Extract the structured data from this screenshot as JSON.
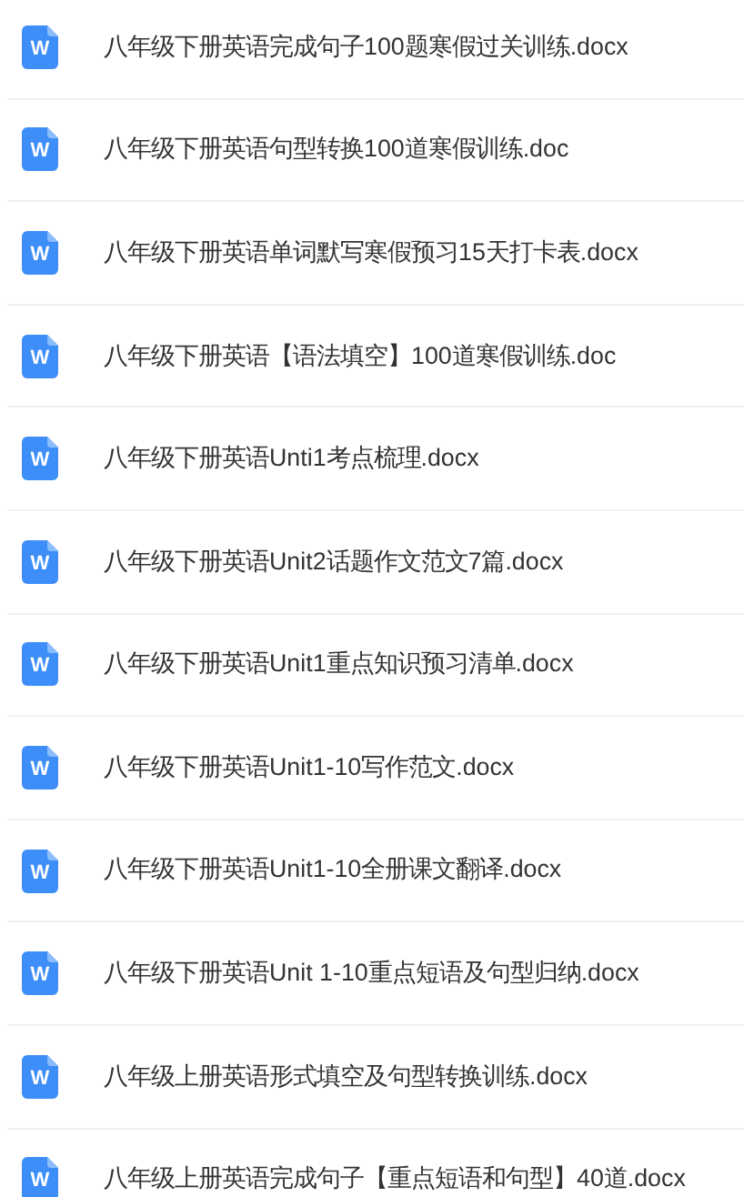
{
  "files": [
    {
      "icon": "W",
      "name": "八年级下册英语完成句子100题寒假过关训练.docx"
    },
    {
      "icon": "W",
      "name": "八年级下册英语句型转换100道寒假训练.doc"
    },
    {
      "icon": "W",
      "name": "八年级下册英语单词默写寒假预习15天打卡表.docx"
    },
    {
      "icon": "W",
      "name": "八年级下册英语【语法填空】100道寒假训练.doc"
    },
    {
      "icon": "W",
      "name": "八年级下册英语Unti1考点梳理.docx"
    },
    {
      "icon": "W",
      "name": "八年级下册英语Unit2话题作文范文7篇.docx"
    },
    {
      "icon": "W",
      "name": "八年级下册英语Unit1重点知识预习清单.docx"
    },
    {
      "icon": "W",
      "name": "八年级下册英语Unit1-10写作范文.docx"
    },
    {
      "icon": "W",
      "name": "八年级下册英语Unit1-10全册课文翻译.docx"
    },
    {
      "icon": "W",
      "name": "八年级下册英语Unit 1-10重点短语及句型归纳.docx"
    },
    {
      "icon": "W",
      "name": "八年级上册英语形式填空及句型转换训练.docx"
    },
    {
      "icon": "W",
      "name": "八年级上册英语完成句子【重点短语和句型】40道.docx"
    }
  ]
}
